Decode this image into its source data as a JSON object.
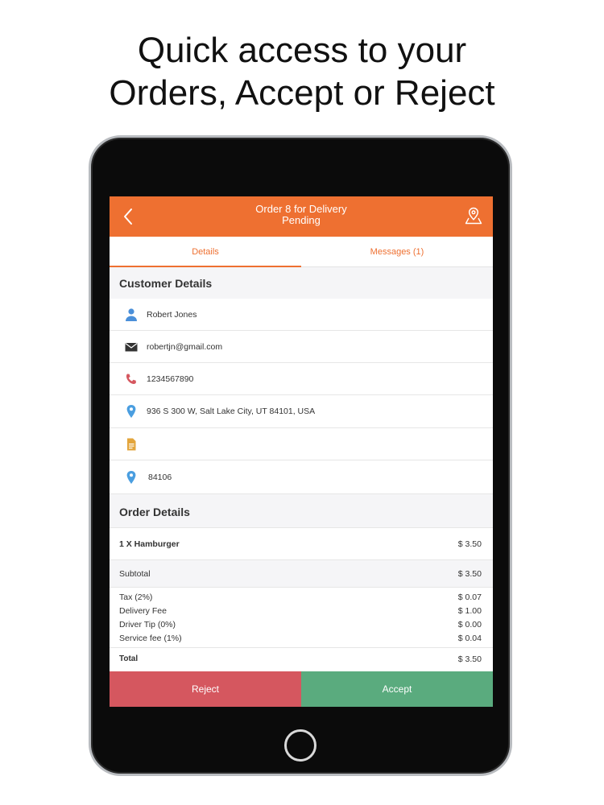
{
  "headline": {
    "line1": "Quick access to your",
    "line2": "Orders, Accept or Reject"
  },
  "app_bar": {
    "title_line1": "Order 8 for Delivery",
    "title_line2": "Pending",
    "back_icon": "chevron-left-icon",
    "map_icon": "map-pin-icon"
  },
  "tabs": [
    {
      "label": "Details",
      "active": true
    },
    {
      "label": "Messages (1)",
      "active": false
    }
  ],
  "customer_details": {
    "heading": "Customer Details",
    "name": "Robert Jones",
    "email": "robertjn@gmail.com",
    "phone": "1234567890",
    "address": "936 S 300 W, Salt Lake City, UT 84101, USA",
    "note": "",
    "zip": "84106"
  },
  "order_details": {
    "heading": "Order Details",
    "item": {
      "label": "1 X Hamburger",
      "price": "$ 3.50"
    },
    "subtotal": {
      "label": "Subtotal",
      "value": "$ 3.50"
    },
    "fees": [
      {
        "label": "Tax (2%)",
        "value": "$ 0.07"
      },
      {
        "label": "Delivery Fee",
        "value": "$ 1.00"
      },
      {
        "label": "Driver Tip (0%)",
        "value": "$ 0.00"
      },
      {
        "label": "Service fee (1%)",
        "value": "$ 0.04"
      }
    ],
    "total": {
      "label": "Total",
      "value": "$ 3.50"
    }
  },
  "actions": {
    "reject": "Reject",
    "accept": "Accept"
  },
  "colors": {
    "accent": "#ee7031",
    "reject": "#d5575f",
    "accept": "#5aab7e"
  }
}
